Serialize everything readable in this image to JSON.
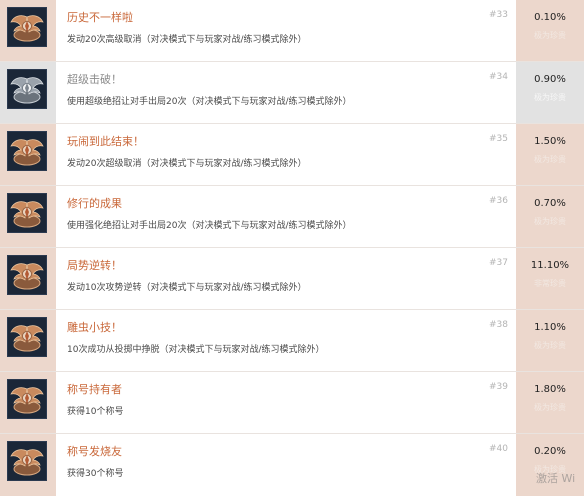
{
  "achievements": [
    {
      "title": "历史不一样啦",
      "desc": "发动20次高级取消（对决模式下与玩家对战/练习模式除外）",
      "num": "#33",
      "percent": "0.10%",
      "rarity": "极为珍贵",
      "locked": false
    },
    {
      "title": "超级击破！",
      "desc": "使用超级绝招让对手出局20次（对决模式下与玩家对战/练习模式除外）",
      "num": "#34",
      "percent": "0.90%",
      "rarity": "极为珍贵",
      "locked": true
    },
    {
      "title": "玩闹到此结束！",
      "desc": "发动20次超级取消（对决模式下与玩家对战/练习模式除外）",
      "num": "#35",
      "percent": "1.50%",
      "rarity": "极为珍贵",
      "locked": false
    },
    {
      "title": "修行的成果",
      "desc": "使用强化绝招让对手出局20次（对决模式下与玩家对战/练习模式除外）",
      "num": "#36",
      "percent": "0.70%",
      "rarity": "极为珍贵",
      "locked": false
    },
    {
      "title": "局势逆转！",
      "desc": "发动10次攻势逆转（对决模式下与玩家对战/练习模式除外）",
      "num": "#37",
      "percent": "11.10%",
      "rarity": "非常珍贵",
      "locked": false
    },
    {
      "title": "雕虫小技！",
      "desc": "10次成功从投掷中挣脱（对决模式下与玩家对战/练习模式除外）",
      "num": "#38",
      "percent": "1.10%",
      "rarity": "极为珍贵",
      "locked": false
    },
    {
      "title": "称号持有者",
      "desc": "获得10个称号",
      "num": "#39",
      "percent": "1.80%",
      "rarity": "极为珍贵",
      "locked": false
    },
    {
      "title": "称号发烧友",
      "desc": "获得30个称号",
      "num": "#40",
      "percent": "0.20%",
      "rarity": "极为珍贵",
      "locked": false
    }
  ],
  "watermark": "激活 Wi",
  "colors": {
    "accent": "#c9683a",
    "panel": "#ecd7cc",
    "locked": "#e2e2e2",
    "badge": "#1b2738"
  },
  "icon": "winged-crest-badge-icon"
}
